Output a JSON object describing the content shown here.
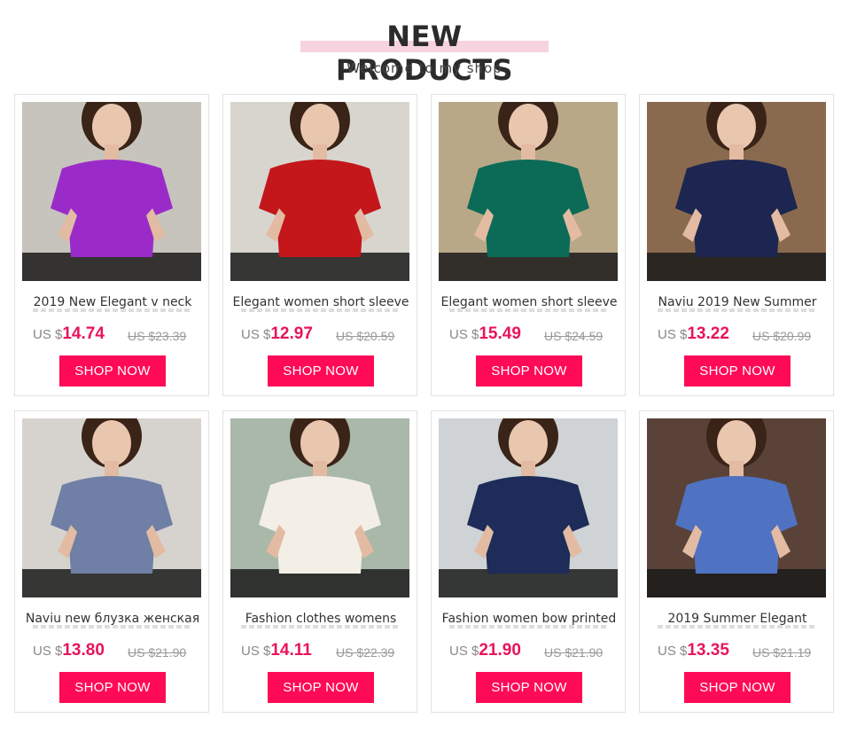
{
  "header": {
    "title": "NEW PRODUCTS",
    "subtitle": "Welcome to my shop"
  },
  "colors": {
    "accent": "#ff0a57",
    "price": "#e8145a",
    "title_highlight": "#f6d3df"
  },
  "products": [
    {
      "name": "2019 New Elegant v neck",
      "currency": "US $",
      "price": "14.74",
      "old_price": "US $23.39",
      "button": "SHOP NOW",
      "shirt": "#9b2bc9",
      "bg": "#c7c3bd"
    },
    {
      "name": "Elegant women short sleeve",
      "currency": "US $",
      "price": "12.97",
      "old_price": "US $20.59",
      "button": "SHOP NOW",
      "shirt": "#c4171c",
      "bg": "#d8d5cf"
    },
    {
      "name": "Elegant women short sleeve",
      "currency": "US $",
      "price": "15.49",
      "old_price": "US $24.59",
      "button": "SHOP NOW",
      "shirt": "#0b6b56",
      "bg": "#b9a888"
    },
    {
      "name": "Naviu 2019 New Summer",
      "currency": "US $",
      "price": "13.22",
      "old_price": "US $20.99",
      "button": "SHOP NOW",
      "shirt": "#1c2650",
      "bg": "#8a6a4e"
    },
    {
      "name": "Naviu new блузка женская",
      "currency": "US $",
      "price": "13.80",
      "old_price": "US $21.90",
      "button": "SHOP NOW",
      "shirt": "#6f7fa6",
      "bg": "#d6d3cf"
    },
    {
      "name": "Fashion clothes womens",
      "currency": "US $",
      "price": "14.11",
      "old_price": "US $22.39",
      "button": "SHOP NOW",
      "shirt": "#f3efe6",
      "bg": "#a9b8a8"
    },
    {
      "name": "Fashion women bow printed",
      "currency": "US $",
      "price": "21.90",
      "old_price": "US $21.90",
      "button": "SHOP NOW",
      "shirt": "#1d2c58",
      "bg": "#cfd3d6"
    },
    {
      "name": "2019 Summer Elegant",
      "currency": "US $",
      "price": "13.35",
      "old_price": "US $21.19",
      "button": "SHOP NOW",
      "shirt": "#4f72c2",
      "bg": "#5a4238"
    }
  ]
}
